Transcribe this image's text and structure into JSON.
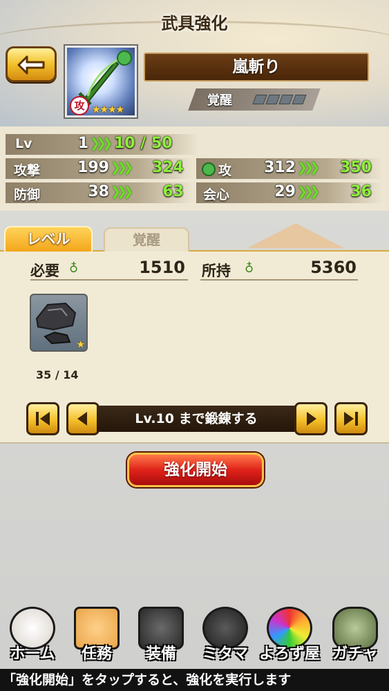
{
  "header": {
    "title": "武具強化"
  },
  "weapon": {
    "name": "嵐斬り",
    "attr_badge": "攻",
    "stars": "★★★★",
    "awaken_label": "覚醒"
  },
  "stats": {
    "lv": {
      "label": "Lv",
      "current": "1",
      "new": "10 / 50"
    },
    "attack": {
      "label": "攻撃",
      "current": "199",
      "new": "324"
    },
    "defense": {
      "label": "防御",
      "current": "38",
      "new": "63"
    },
    "magatama_attack": {
      "label": "攻",
      "current": "312",
      "new": "350"
    },
    "critical": {
      "label": "会心",
      "current": "29",
      "new": "36"
    }
  },
  "tabs": {
    "level": "レベル",
    "awaken": "覚醒"
  },
  "cost": {
    "required_label": "必要",
    "required_value": "1510",
    "owned_label": "所持",
    "owned_value": "5360"
  },
  "material": {
    "count": "35 / 14"
  },
  "forge": {
    "label": "Lv.10 まで鍛錬する"
  },
  "start_button": "強化開始",
  "bottom_nav": [
    {
      "label": "ホーム",
      "icon": "fox-icon",
      "color": "#e9e4de"
    },
    {
      "label": "任務",
      "icon": "scroll-icon",
      "color": "#e9a64a"
    },
    {
      "label": "装備",
      "icon": "armor-icon",
      "color": "#3a3a3a"
    },
    {
      "label": "ミタマ",
      "icon": "magatama-icon",
      "color": "#2e2e2e"
    },
    {
      "label": "よろず屋",
      "icon": "lotus-icon",
      "color": "#c236b0"
    },
    {
      "label": "ガチャ",
      "icon": "stone-icon",
      "color": "#8aa06a"
    }
  ],
  "tip": "「強化開始」をタップすると、強化を実行します"
}
